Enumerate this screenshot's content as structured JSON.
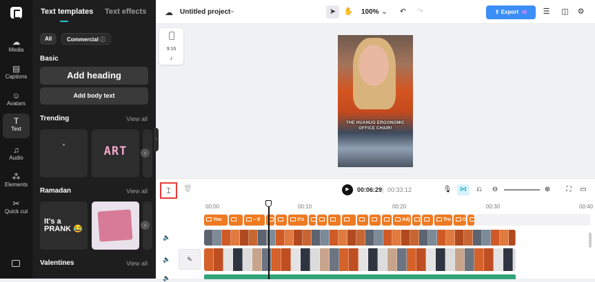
{
  "rail": {
    "items": [
      {
        "label": "Media",
        "icon": "cloud-upload-icon"
      },
      {
        "label": "Captions",
        "icon": "captions-icon"
      },
      {
        "label": "Avatars",
        "icon": "avatar-icon"
      },
      {
        "label": "Text",
        "icon": "text-icon",
        "active": true
      },
      {
        "label": "Audio",
        "icon": "music-note-icon"
      },
      {
        "label": "Elements",
        "icon": "elements-icon"
      },
      {
        "label": "Quick cut",
        "icon": "scissors-icon"
      }
    ]
  },
  "panel": {
    "tabs": [
      "Text templates",
      "Text effects"
    ],
    "filters": [
      "All",
      "Commercial"
    ],
    "basic": {
      "title": "Basic",
      "add_heading": "Add heading",
      "add_body": "Add body text"
    },
    "trending": {
      "title": "Trending",
      "view_all": "View all",
      "thumb2_text": "ART"
    },
    "ramadan": {
      "title": "Ramadan",
      "view_all": "View all",
      "thumb1_text": "It's a PRANK 😂"
    },
    "valentines": {
      "title": "Valentines",
      "view_all": "View all"
    }
  },
  "topbar": {
    "project_title": "Untitled project",
    "zoom": "100%",
    "export": "Export",
    "accent": "#3a8ef6"
  },
  "ratio": {
    "label": "9:16"
  },
  "preview": {
    "caption_line1": "THE HUANUO ERGONOMIC",
    "caption_line2": "OFFICE CHAIR!"
  },
  "timeline": {
    "current_time": "00:06:29",
    "separator": "|",
    "total_time": "00:33:12",
    "ruler": [
      "00:00",
      "00:10",
      "00:20",
      "00:30",
      "00:40"
    ],
    "text_clips": [
      "You",
      "",
      "– tl",
      "",
      "",
      "it's",
      "",
      "",
      "",
      "",
      "",
      "",
      "",
      "Adj",
      "",
      "",
      "Tru",
      "Gr",
      ""
    ],
    "accent_orange": "#ee7a21",
    "accent_green": "#33a37a"
  }
}
